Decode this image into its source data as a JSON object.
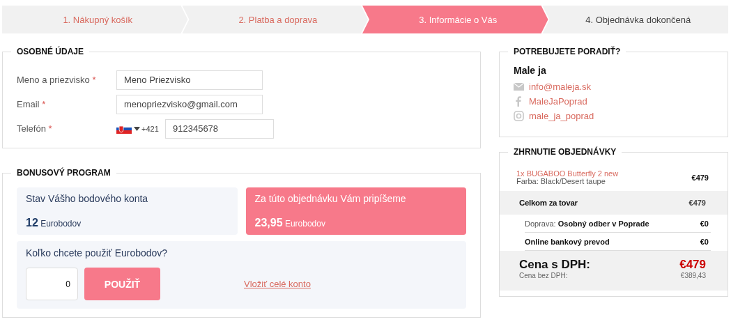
{
  "steps": [
    {
      "label": "1. Nákupný košík",
      "selected": false,
      "completed": true
    },
    {
      "label": "2. Platba a doprava",
      "selected": false,
      "completed": true
    },
    {
      "label": "3. Informácie o Vás",
      "selected": true,
      "completed": false
    },
    {
      "label": "4. Objednávka dokončená",
      "selected": false,
      "completed": false
    }
  ],
  "personal": {
    "title": "OSOBNÉ ÚDAJE",
    "fields": [
      {
        "label": "Meno a priezvisko",
        "required_mark": "*",
        "value": "Meno Priezvisko",
        "kind": "text"
      },
      {
        "label": "Email",
        "required_mark": "*",
        "value": "menopriezvisko@gmail.com",
        "kind": "text"
      },
      {
        "label": "Telefón",
        "required_mark": "*",
        "prefix": "+421",
        "value": "912345678",
        "kind": "phone"
      }
    ]
  },
  "bonus": {
    "title": "BONUSOVÝ PROGRAM",
    "balance": {
      "label": "Stav Vášho bodového konta",
      "amount": "12",
      "unit": "Eurobodov"
    },
    "earn": {
      "label": "Za túto objednávku Vám pripíšeme",
      "amount": "23,95",
      "unit": "Eurobodov"
    },
    "use": {
      "question": "Koľko chcete použiť Eurobodov?",
      "value": "0",
      "button": "POUŽIŤ",
      "link": "Vložiť celé konto"
    }
  },
  "help": {
    "title": "POTREBUJETE PORADIŤ?",
    "name": "Male ja",
    "contacts": [
      {
        "kind": "email",
        "text": "info@maleja.sk"
      },
      {
        "kind": "facebook",
        "text": "MaleJaPoprad"
      },
      {
        "kind": "instagram",
        "text": "male_ja_poprad"
      }
    ]
  },
  "summary": {
    "title": "ZHRNUTIE OBJEDNÁVKY",
    "rows": [
      {
        "kind": "item",
        "name": "1x BUGABOO Butterfly 2 new",
        "detail": "Farba: Black/Desert taupe",
        "price": "€479"
      },
      {
        "kind": "subtotal",
        "name": "Celkom za tovar",
        "price": "€479"
      },
      {
        "kind": "line",
        "name": "Doprava: **Osobný odber v Poprade**",
        "price": "€0"
      },
      {
        "kind": "line",
        "name": "**Online bankový prevod**",
        "price": "€0"
      },
      {
        "kind": "total",
        "name": "Cena s DPH:",
        "detail": "Cena bez DPH:",
        "price": "€479",
        "detail_price": "€389,43"
      }
    ]
  }
}
